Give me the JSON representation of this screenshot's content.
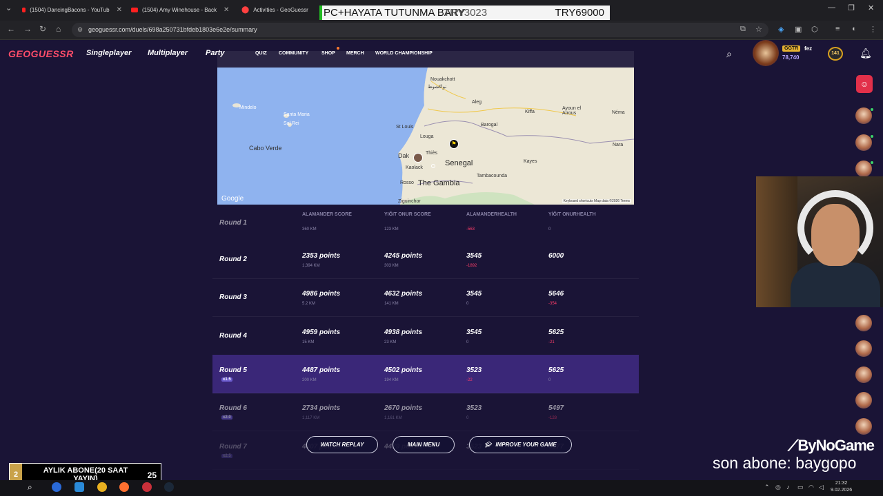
{
  "browser": {
    "tabs": [
      {
        "title": "(1504) DancingBacons - YouTub"
      },
      {
        "title": "(1504) Amy Winehouse - Back"
      },
      {
        "title": "Activities - GeoGuessr"
      }
    ],
    "url": "geoguessr.com/duels/698a250731bfdeb1803e6e2e/summary"
  },
  "stream_bar": {
    "left_text": "PC+HAYATA TUTUNMA BARY",
    "middle_text": "TRY3023",
    "right_text": "TRY69000"
  },
  "header": {
    "logo": "GEOGUESSR",
    "nav": [
      "Singleplayer",
      "Multiplayer",
      "Party"
    ],
    "subnav": [
      "QUIZ",
      "COMMUNITY",
      "SHOP",
      "MERCH",
      "WORLD CHAMPIONSHIP"
    ],
    "badge": "GGTR",
    "username": "fez",
    "coins": "78,740",
    "level": "141"
  },
  "map": {
    "labels": {
      "nouakchott": "Nouakchott",
      "nouakchott_ar": "نواكشوط",
      "aleg": "Aleg",
      "kiffa": "Kiffa",
      "ayoun": "Ayoun el Atrous",
      "nema": "Néma",
      "rosso": "Rosso",
      "stlouis": "St Louis",
      "louga": "Louga",
      "barogal": "Barogal",
      "dakar": "Dak",
      "thies": "Thiès",
      "kaolack": "Kaolack",
      "senegal": "Senegal",
      "kayes": "Kayes",
      "nara": "Nara",
      "tamba": "Tambacounda",
      "gambia": "The Gambia",
      "ziguinchor": "Ziguinchor",
      "cabo_verde": "Cabo Verde",
      "mindelo": "Mindelo",
      "santa_maria": "Santa Maria",
      "sal_rei": "Sal Rei"
    },
    "attribution": "Google",
    "footer": "Keyboard shortcuts    Map data ©2026    Terms"
  },
  "table": {
    "headers": [
      "ALAMANDER SCORE",
      "YIĞIT ONUR SCORE",
      "ALAMANDERHEALTH",
      "YİĞIT ONURHEALTH"
    ],
    "partial_row": {
      "name": "Round 1",
      "a_dist": "360 KM",
      "b_dist": "123 KM",
      "a_delta": "-563",
      "b_delta": "0"
    },
    "rows": [
      {
        "name": "Round 2",
        "mult": "",
        "a_pts": "2353 points",
        "a_dist": "1,394 KM",
        "b_pts": "4245 points",
        "b_dist": "303 KM",
        "a_hp": "3545",
        "a_delta": "-1892",
        "b_hp": "6000",
        "b_delta": ""
      },
      {
        "name": "Round 3",
        "mult": "",
        "a_pts": "4986 points",
        "a_dist": "5.2 KM",
        "b_pts": "4632 points",
        "b_dist": "141 KM",
        "a_hp": "3545",
        "a_delta": "0",
        "b_hp": "5646",
        "b_delta": "-354"
      },
      {
        "name": "Round 4",
        "mult": "",
        "a_pts": "4959 points",
        "a_dist": "15 KM",
        "b_pts": "4938 points",
        "b_dist": "23 KM",
        "a_hp": "3545",
        "a_delta": "0",
        "b_hp": "5625",
        "b_delta": "-21"
      },
      {
        "name": "Round 5",
        "mult": "x1.5",
        "a_pts": "4487 points",
        "a_dist": "200 KM",
        "b_pts": "4502 points",
        "b_dist": "194 KM",
        "a_hp": "3523",
        "a_delta": "-22",
        "b_hp": "5625",
        "b_delta": "0"
      },
      {
        "name": "Round 6",
        "mult": "x2.0",
        "a_pts": "2734 points",
        "a_dist": "1,117 KM",
        "b_pts": "2670 points",
        "b_dist": "1,161 KM",
        "a_hp": "3523",
        "a_delta": "0",
        "b_hp": "5497",
        "b_delta": "-128"
      },
      {
        "name": "Round 7",
        "mult": "x2.5",
        "a_pts": "4807 points",
        "a_dist": "",
        "b_pts": "4479 points",
        "b_dist": "",
        "a_hp": "3523",
        "a_delta": "",
        "b_hp": "5177",
        "b_delta": ""
      }
    ]
  },
  "buttons": {
    "watch_replay": "WATCH REPLAY",
    "main_menu": "MAIN MENU",
    "improve": "IMPROVE YOUR GAME"
  },
  "stream": {
    "brand": "ByNoGame",
    "last_sub": "son abone: baygopo",
    "sub_goal_current": "2",
    "sub_goal_text": "AYLIK ABONE(20 SAAT YAYIN)",
    "sub_goal_target": "25"
  },
  "taskbar": {
    "time": "21:32",
    "date": "9.02.2026"
  }
}
